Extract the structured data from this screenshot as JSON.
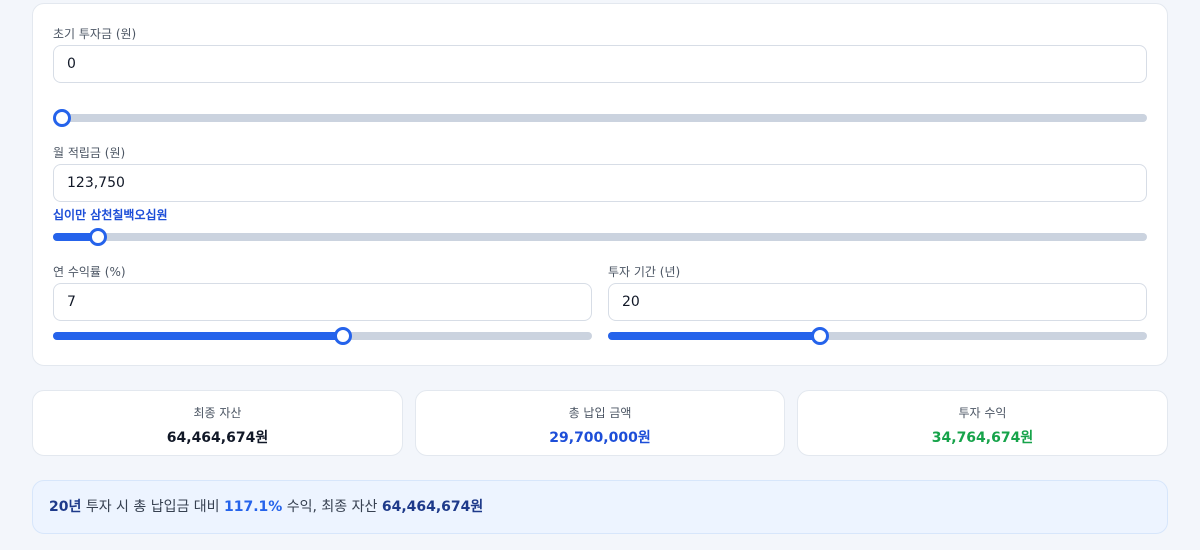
{
  "inputs": {
    "initial": {
      "label": "초기 투자금 (원)",
      "value": "0",
      "slider_fraction": 0
    },
    "monthly": {
      "label": "월 적립금 (원)",
      "value": "123,750",
      "korean": "십이만 삼천칠백오십원",
      "slider_fraction": 0.041
    },
    "rate": {
      "label": "연 수익률 (%)",
      "value": "7",
      "slider_fraction": 0.538
    },
    "period": {
      "label": "투자 기간 (년)",
      "value": "20",
      "slider_fraction": 0.393
    }
  },
  "stats": {
    "final": {
      "title": "최종 자산",
      "value": "64,464,674원",
      "color": "#111827"
    },
    "paid": {
      "title": "총 납입 금액",
      "value": "29,700,000원",
      "color": "#1d4ed8"
    },
    "profit": {
      "title": "투자 수익",
      "value": "34,764,674원",
      "color": "#16a34a"
    }
  },
  "summary": {
    "years": "20년",
    "text1": " 투자 시 총 납입금 대비 ",
    "pct": "117.1%",
    "text2": " 수익, 최종 자산 ",
    "final": "64,464,674원"
  },
  "colors": {
    "accent": "#2563eb",
    "track": "#cbd3df"
  }
}
